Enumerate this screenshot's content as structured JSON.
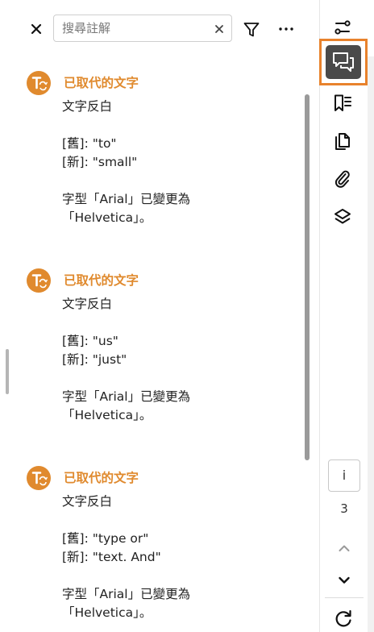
{
  "search": {
    "placeholder": "搜尋註解"
  },
  "comments": [
    {
      "title": "已取代的文字",
      "style": "文字反白",
      "old_line": "[舊]: \"to\"",
      "new_line": "[新]: \"small\"",
      "font_line_1": "字型「Arial」已變更為",
      "font_line_2": "「Helvetica」。"
    },
    {
      "title": "已取代的文字",
      "style": "文字反白",
      "old_line": "[舊]: \"us\"",
      "new_line": "[新]: \"just\"",
      "font_line_1": "字型「Arial」已變更為",
      "font_line_2": "「Helvetica」。"
    },
    {
      "title": "已取代的文字",
      "style": "文字反白",
      "old_line": "[舊]: \"type or\"",
      "new_line": "[新]: \"text.  And\"",
      "font_line_1": "字型「Arial」已變更為",
      "font_line_2": "「Helvetica」。"
    }
  ],
  "rail": {
    "info_label": "i",
    "page_number": "3",
    "icons": [
      "tools-icon",
      "comments-icon",
      "bookmarks-icon",
      "pages-icon",
      "attachments-icon",
      "layers-icon"
    ]
  },
  "colors": {
    "accent": "#e08a2e",
    "active_border": "#e8822c",
    "active_bg": "#4a4a4a"
  }
}
